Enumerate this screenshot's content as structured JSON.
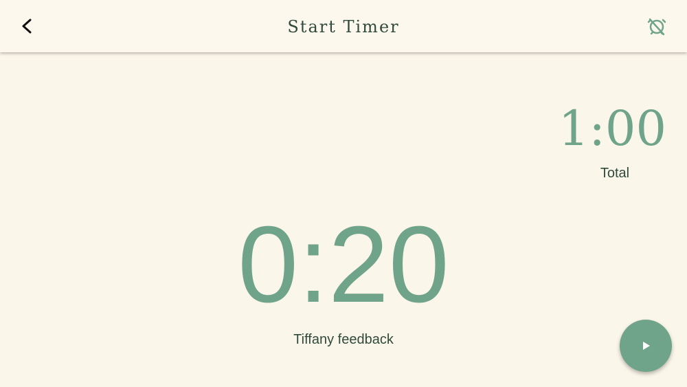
{
  "header": {
    "title": "Start Timer",
    "back_icon": "chevron-left-icon",
    "alarm_icon": "alarm-off-icon"
  },
  "timer": {
    "total_time": "1:00",
    "total_label": "Total",
    "current_time": "0:20",
    "segment_label": "Tiffany feedback"
  },
  "actions": {
    "play_icon": "play-icon"
  },
  "colors": {
    "background": "#fbf6ea",
    "accent": "#6fa48a",
    "text_dark": "#2f4a3b"
  }
}
